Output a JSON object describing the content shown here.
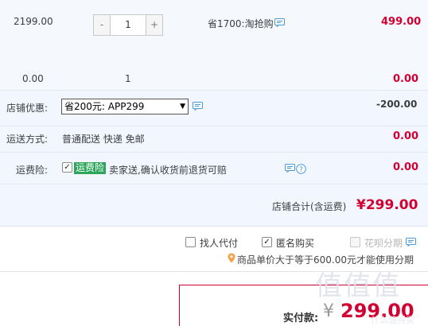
{
  "item": {
    "unit_price": "2199.00",
    "quantity": "1",
    "qty_minus": "-",
    "qty_plus": "+",
    "promo": "省1700:淘抢购",
    "subtotal": "499.00"
  },
  "bundle": {
    "price": "0.00",
    "quantity": "1",
    "subtotal": "0.00"
  },
  "shop_discount": {
    "label": "店铺优惠:",
    "selected_option": "省200元: APP299",
    "amount": "-200.00"
  },
  "shipping": {
    "label": "运送方式:",
    "value": "普通配送 快递 免邮",
    "amount": "0.00"
  },
  "insurance": {
    "label": "运费险:",
    "badge": "运费险",
    "description": "卖家送,确认收货前退货可赔",
    "amount": "0.00"
  },
  "shop_total": {
    "label": "店铺合计(含运费)",
    "value": "¥299.00"
  },
  "options": {
    "pay_for_me": "找人代付",
    "anonymous": "匿名购买",
    "huabei": "花呗分期",
    "huabei_tip": "商品单价大于等于600.00元才能使用分期"
  },
  "final": {
    "label": "实付款:",
    "currency": "¥",
    "amount": "299.00"
  },
  "watermark": {
    "main": "值值值",
    "small": "什么值得买"
  },
  "colors": {
    "price_red": "#d20031",
    "badge_green": "#2aa55a",
    "panel_blue": "#f2f7ff",
    "icon_blue": "#4b9ad8",
    "tip_orange": "#f5a147"
  }
}
